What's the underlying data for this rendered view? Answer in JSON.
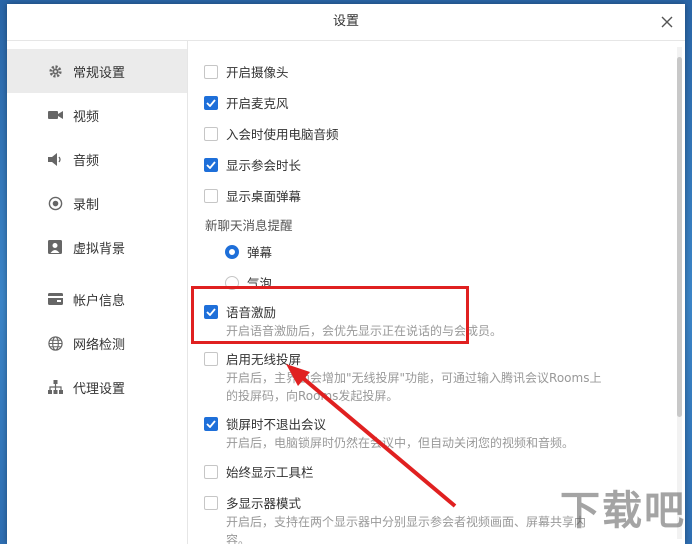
{
  "window": {
    "title": "设置"
  },
  "sidebar": {
    "items": [
      {
        "label": "常规设置",
        "icon": "gear-icon",
        "active": true
      },
      {
        "label": "视频",
        "icon": "video-camera-icon",
        "active": false
      },
      {
        "label": "音频",
        "icon": "speaker-icon",
        "active": false
      },
      {
        "label": "录制",
        "icon": "record-icon",
        "active": false
      },
      {
        "label": "虚拟背景",
        "icon": "person-portrait-icon",
        "active": false
      },
      {
        "label": "帐户信息",
        "icon": "wallet-icon",
        "active": false
      },
      {
        "label": "网络检测",
        "icon": "globe-icon",
        "active": false
      },
      {
        "label": "代理设置",
        "icon": "network-tree-icon",
        "active": false
      }
    ]
  },
  "settings": {
    "camera": {
      "label": "开启摄像头",
      "checked": false
    },
    "mic": {
      "label": "开启麦克风",
      "checked": true
    },
    "pc_audio": {
      "label": "入会时使用电脑音频",
      "checked": false
    },
    "duration": {
      "label": "显示参会时长",
      "checked": true
    },
    "danmaku": {
      "label": "显示桌面弹幕",
      "checked": false
    },
    "chat_section": "新聊天消息提醒",
    "radio_danmaku": {
      "label": "弹幕",
      "selected": true
    },
    "radio_bubble": {
      "label": "气泡",
      "selected": false
    },
    "voice_motivation": {
      "label": "语音激励",
      "checked": true,
      "desc": "开启语音激励后，会优先显示正在说话的与会成员。"
    },
    "wireless": {
      "label": "启用无线投屏",
      "checked": false,
      "desc": "开启后，主界面会增加\"无线投屏\"功能，可通过输入腾讯会议Rooms上的投屏码，向Rooms发起投屏。"
    },
    "lock_screen": {
      "label": "锁屏时不退出会议",
      "checked": true,
      "desc": "开启后，电脑锁屏时仍然在会议中，但自动关闭您的视频和音频。"
    },
    "toolbar": {
      "label": "始终显示工具栏",
      "checked": false
    },
    "multi_display": {
      "label": "多显示器模式",
      "checked": false,
      "desc": "开启后，支持在两个显示器中分别显示参会者视频画面、屏幕共享内容。"
    }
  },
  "colors": {
    "accent": "#1e6fd9",
    "highlight": "#e02020"
  },
  "watermark": "下载吧"
}
